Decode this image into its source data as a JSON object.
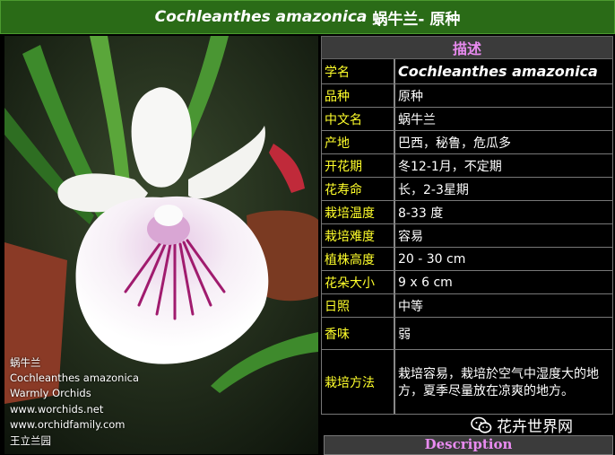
{
  "header": {
    "latin_name": "Cochleanthes amazonica",
    "chinese_title": "蜗牛兰- 原种"
  },
  "table": {
    "heading": "描述",
    "rows": [
      {
        "label": "学名",
        "value": "Cochleanthes amazonica"
      },
      {
        "label": "品种",
        "value": "原种"
      },
      {
        "label": "中文名",
        "value": "蜗牛兰"
      },
      {
        "label": "产地",
        "value": "巴西，秘鲁，危瓜多"
      },
      {
        "label": "开花期",
        "value": "冬12-1月，不定期"
      },
      {
        "label": "花寿命",
        "value": "长，2-3星期"
      },
      {
        "label": "栽培温度",
        "value": "8-33 度"
      },
      {
        "label": "栽培难度",
        "value": "容易"
      },
      {
        "label": "植株高度",
        "value": "20 - 30 cm"
      },
      {
        "label": "花朵大小",
        "value": "9 x 6 cm"
      },
      {
        "label": "日照",
        "value": "中等"
      },
      {
        "label": "香味",
        "value": "弱"
      },
      {
        "label": "栽培方法",
        "value": "栽培容易，栽培於空气中湿度大的地方，夏季尽量放在凉爽的地方。"
      }
    ]
  },
  "photo_caption": {
    "line1": "蜗牛兰",
    "line2": "Cochleanthes amazonica",
    "line3": "Warmly Orchids",
    "line4": "www.worchids.net",
    "line5": "www.orchidfamily.com",
    "line6": "王立兰园"
  },
  "description_heading": "Description",
  "watermark": {
    "text": "花卉世界网",
    "icon": "wechat-icon"
  }
}
